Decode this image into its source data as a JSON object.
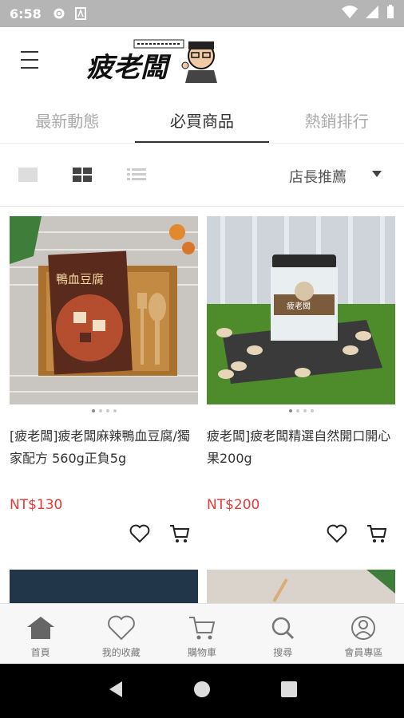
{
  "status": {
    "time": "6:58"
  },
  "header": {
    "logo_text": "疲老闆"
  },
  "tabs": [
    {
      "label": "最新動態"
    },
    {
      "label": "必買商品"
    },
    {
      "label": "熱銷排行"
    }
  ],
  "toolbar": {
    "sort_label": "店長推薦"
  },
  "products": [
    {
      "name": "[疲老闆]疲老闆麻辣鴨血豆腐/獨家配方 560g正負5g",
      "price": "NT$130",
      "image_label": "鴨血豆腐"
    },
    {
      "name": "疲老闆]疲老闆精選自然開口開心果200g",
      "price": "NT$200",
      "image_label": "疲老闆"
    }
  ],
  "bottom_nav": [
    {
      "label": "首頁",
      "icon": "home-icon"
    },
    {
      "label": "我的收藏",
      "icon": "heart-icon"
    },
    {
      "label": "購物車",
      "icon": "cart-icon"
    },
    {
      "label": "搜尋",
      "icon": "search-icon"
    },
    {
      "label": "會員專區",
      "icon": "user-icon"
    }
  ]
}
